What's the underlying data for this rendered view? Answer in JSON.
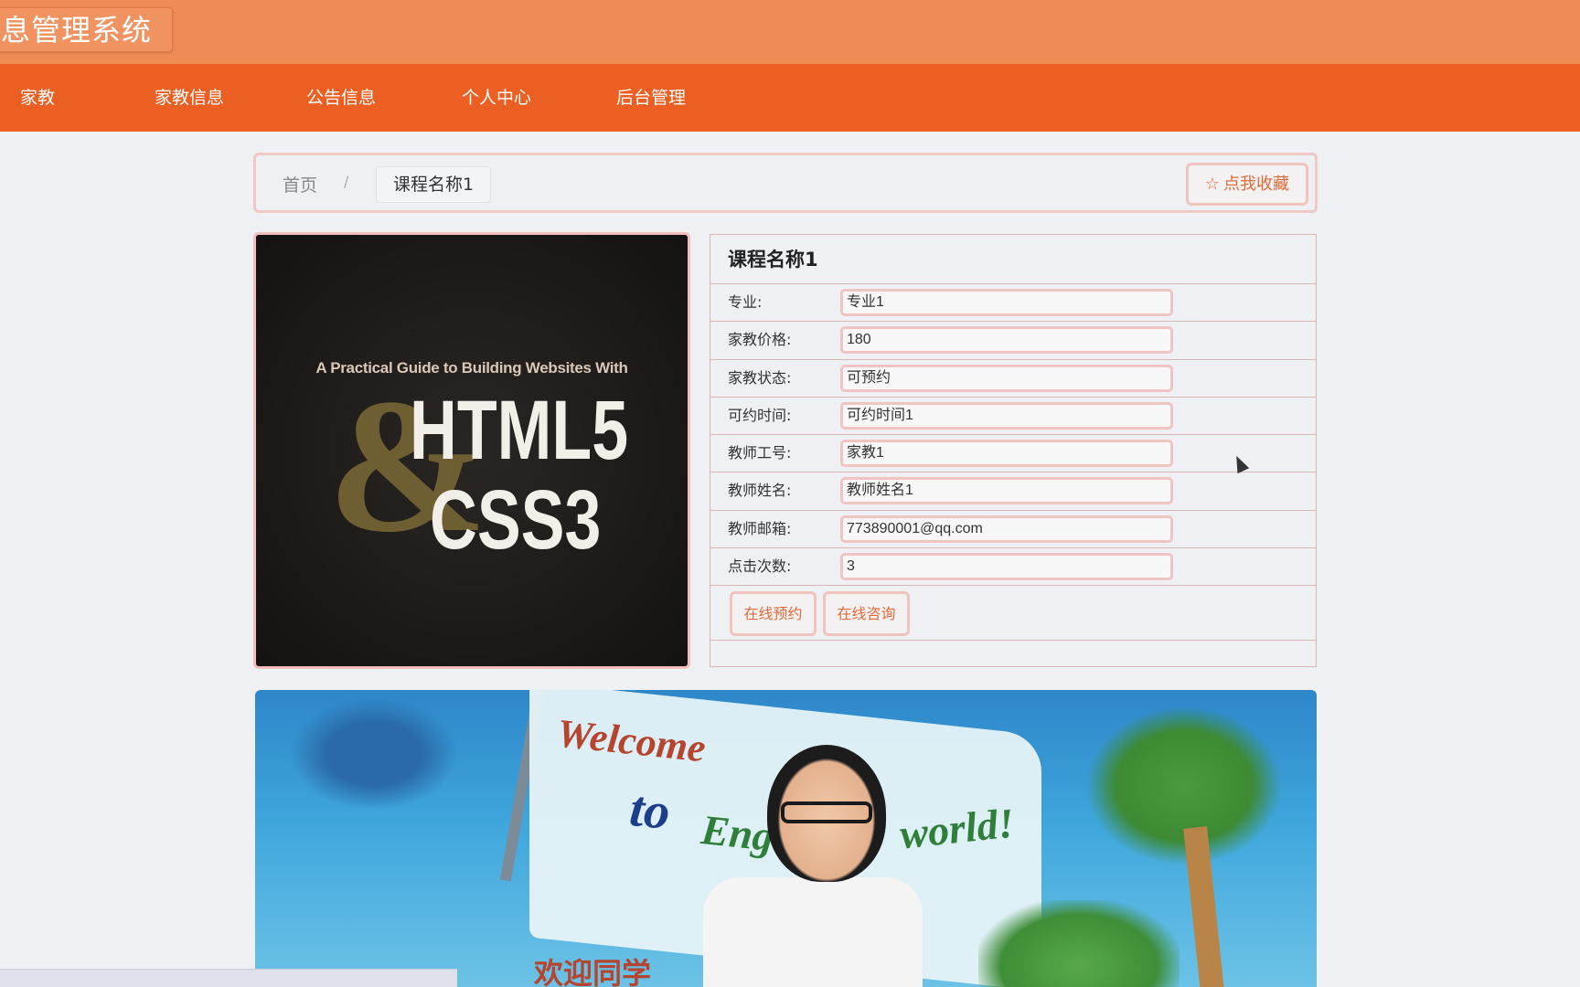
{
  "header": {
    "brand": "息管理系统"
  },
  "nav": {
    "items": [
      {
        "label": "家教"
      },
      {
        "label": "家教信息"
      },
      {
        "label": "公告信息"
      },
      {
        "label": "个人中心"
      },
      {
        "label": "后台管理"
      }
    ]
  },
  "breadcrumb": {
    "home": "首页",
    "separator": "/",
    "current": "课程名称1"
  },
  "favorite_button": {
    "icon": "star-icon",
    "label": "点我收藏"
  },
  "cover": {
    "subtitle": "A Practical Guide to Building Websites With",
    "amp": "&",
    "line1": "HTML5",
    "line2": "CSS3"
  },
  "detail": {
    "title": "课程名称1",
    "fields": [
      {
        "label": "专业:",
        "value": "专业1"
      },
      {
        "label": "家教价格:",
        "value": "180"
      },
      {
        "label": "家教状态:",
        "value": "可预约"
      },
      {
        "label": "可约时间:",
        "value": "可约时间1"
      },
      {
        "label": "教师工号:",
        "value": "家教1"
      },
      {
        "label": "教师姓名:",
        "value": "教师姓名1"
      },
      {
        "label": "教师邮箱:",
        "value": "773890001@qq.com"
      },
      {
        "label": "点击次数:",
        "value": "3"
      }
    ],
    "actions": {
      "book": "在线预约",
      "consult": "在线咨询"
    }
  },
  "banner": {
    "welcome": "Welcome",
    "to": "to",
    "eng": "Eng",
    "world": "world!",
    "cn": "欢迎同学"
  },
  "colors": {
    "topbar": "#ef8b57",
    "navbar": "#ec5f22",
    "accent": "#e06a3a",
    "border_pink": "#f0c4c2"
  }
}
